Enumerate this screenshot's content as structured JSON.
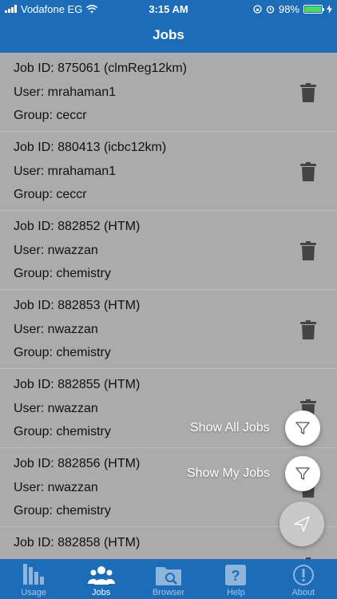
{
  "status_bar": {
    "carrier": "Vodafone EG",
    "time": "3:15 AM",
    "battery": "98%",
    "battery_level": 0.98
  },
  "nav": {
    "title": "Jobs"
  },
  "jobs": [
    {
      "job_id": "Job ID: 875061 (clmReg12km)",
      "user": "User: mrahaman1",
      "group": "Group: ceccr"
    },
    {
      "job_id": "Job ID: 880413 (icbc12km)",
      "user": "User: mrahaman1",
      "group": "Group: ceccr"
    },
    {
      "job_id": "Job ID: 882852 (HTM)",
      "user": "User: nwazzan",
      "group": "Group: chemistry"
    },
    {
      "job_id": "Job ID: 882853 (HTM)",
      "user": "User: nwazzan",
      "group": "Group: chemistry"
    },
    {
      "job_id": "Job ID: 882855 (HTM)",
      "user": "User: nwazzan",
      "group": "Group: chemistry"
    },
    {
      "job_id": "Job ID: 882856 (HTM)",
      "user": "User: nwazzan",
      "group": "Group: chemistry"
    },
    {
      "job_id": "Job ID: 882858 (HTM)",
      "user": "",
      "group": ""
    }
  ],
  "fab_menu": {
    "show_all": "Show All Jobs",
    "show_my": "Show My Jobs"
  },
  "tabs": [
    {
      "label": "Usage",
      "icon": "bar-chart-icon"
    },
    {
      "label": "Jobs",
      "icon": "users-icon",
      "active": true
    },
    {
      "label": "Browser",
      "icon": "folder-search-icon"
    },
    {
      "label": "Help",
      "icon": "question-icon"
    },
    {
      "label": "About",
      "icon": "info-icon"
    }
  ],
  "colors": {
    "primary": "#1d6cb8",
    "overlay": "#ababab",
    "battery": "#4cd964"
  }
}
